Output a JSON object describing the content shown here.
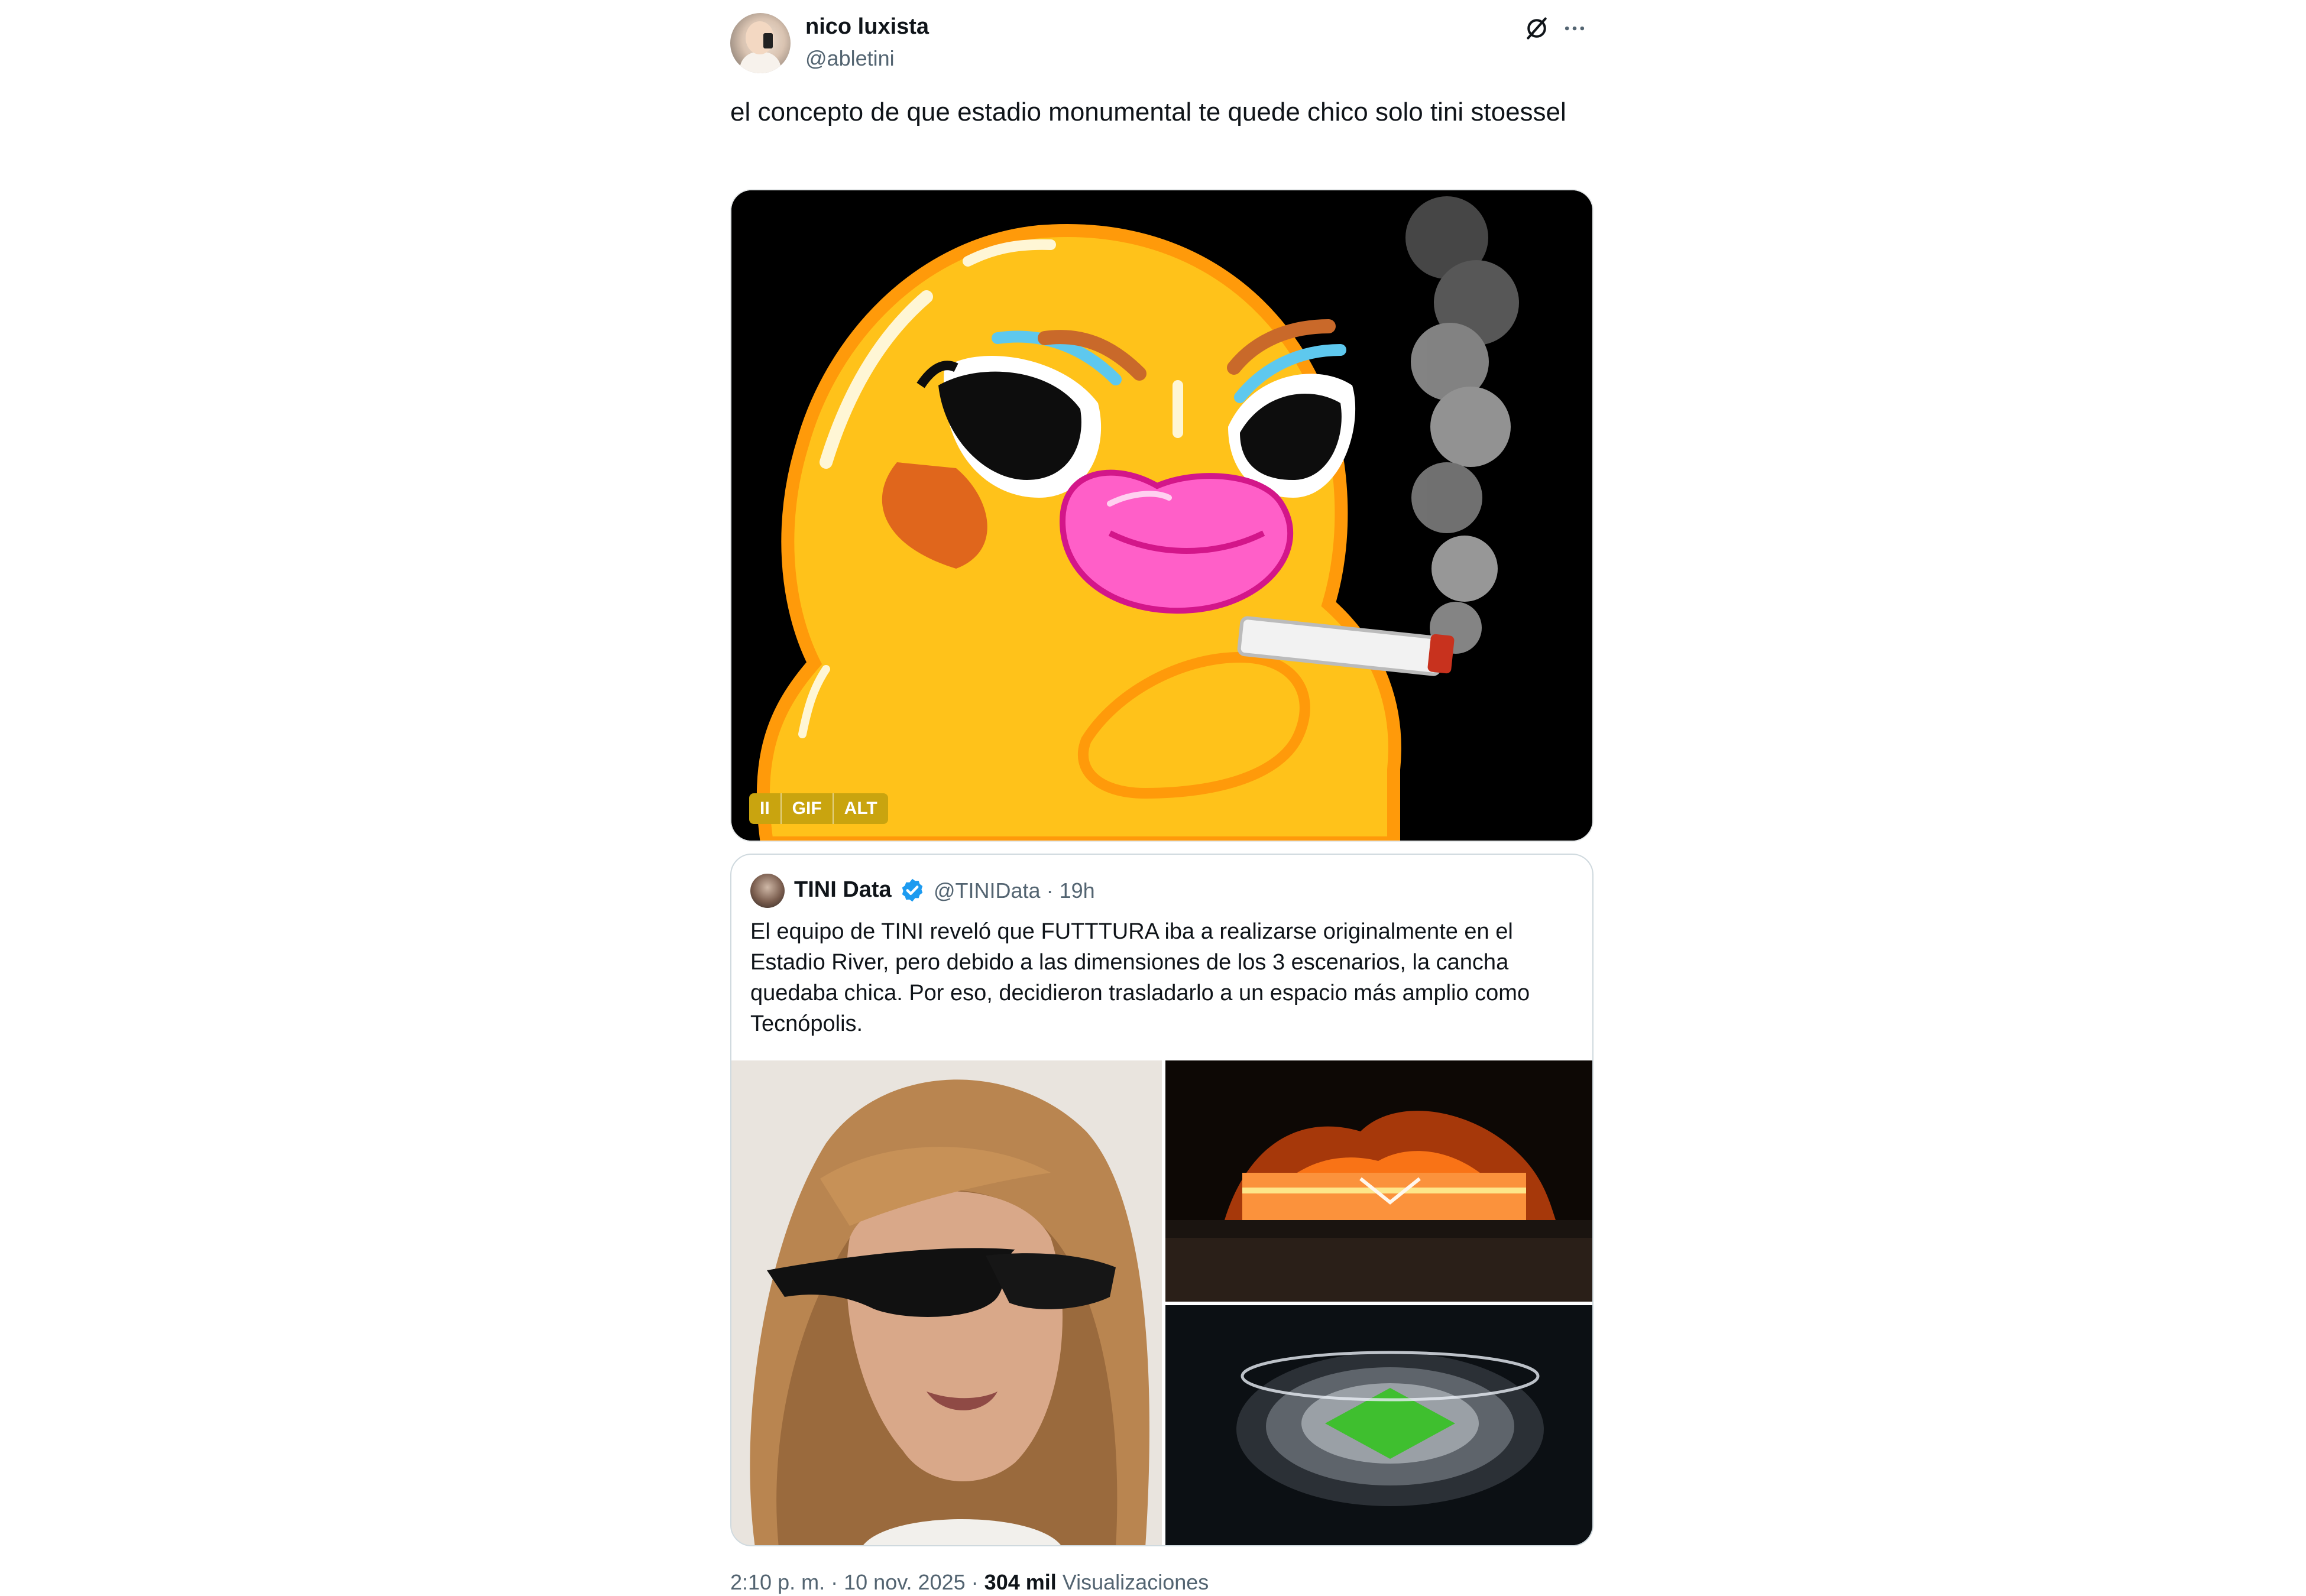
{
  "tweet": {
    "author_name": "nico luxista",
    "author_handle": "@abletini",
    "text": "el concepto de que estadio monumental te quede chico solo tini stoessel",
    "media_badges": {
      "pause": "II",
      "gif": "GIF",
      "alt": "ALT"
    },
    "footer": {
      "time": "2:10 p. m.",
      "separator": "·",
      "date": "10 nov. 2025",
      "views_count": "304 mil",
      "views_label": "Visualizaciones"
    }
  },
  "quote": {
    "author_name": "TINI Data",
    "author_handle": "@TINIData",
    "time": "· 19h",
    "text": "El equipo de TINI reveló que FUTTTURA iba a realizarse originalmente en el Estadio River, pero debido a las dimensiones de los 3 escenarios, la cancha quedaba chica. Por eso, decidieron trasladarlo a un espacio más amplio como Tecnópolis."
  },
  "icons": {
    "grok": "grok-icon",
    "more": "more-icon",
    "verified": "verified-icon"
  },
  "colors": {
    "verified_blue": "#1d9bf0",
    "duck_yellow": "#ffc21a",
    "duck_outline": "#ff9a0a",
    "beak_pink": "#ff5fc8"
  }
}
